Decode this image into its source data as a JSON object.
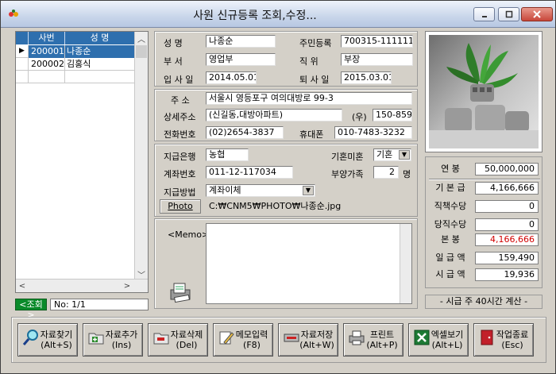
{
  "window": {
    "title": "사원 신규등록 조회,수정..."
  },
  "grid": {
    "columns": [
      "사번",
      "성 명"
    ],
    "rows": [
      {
        "id": "200001",
        "name": "나종순",
        "selected": true
      },
      {
        "id": "200002",
        "name": "김홍식",
        "selected": false
      }
    ],
    "row_marker": "▶"
  },
  "status": {
    "query_label": "<조회>",
    "count": "No: 1/1"
  },
  "basic": {
    "name_label": "성    명",
    "name": "나종순",
    "dept_label": "부    서",
    "dept": "영업부",
    "hire_label": "입 사 일",
    "hire_date": "2014.05.01",
    "rrn_label": "주민등록",
    "rrn": "700315-111111",
    "position_label": "직    위",
    "position": "부장",
    "retire_label": "퇴 사 일",
    "retire_date": "2015.03.01"
  },
  "contact": {
    "address_label": "주    소",
    "address": "서울시 영등포구 여의대방로 99-3",
    "detail_label": "상세주소",
    "detail": "(신길동,대방아파트)",
    "zip_label": "(우)",
    "zip": "150-859",
    "phone_label": "전화번호",
    "phone": "(02)2654-3837",
    "mobile_label": "휴대폰",
    "mobile": "010-7483-3232"
  },
  "payment": {
    "bank_label": "지급은행",
    "bank": "농협",
    "account_label": "계좌번호",
    "account": "011-12-117034",
    "method_label": "지급방법",
    "method": "계좌이체",
    "marital_label": "기혼미혼",
    "marital": "기혼",
    "dependents_label": "부양가족",
    "dependents": "2",
    "dependents_unit": "명",
    "photo_button": "Photo",
    "photo_path": "C:₩CNM5₩PHOTO₩나종순.jpg"
  },
  "memo": {
    "label": "<Memo>",
    "value": ""
  },
  "salary": {
    "annual_label": "연    봉",
    "annual": "50,000,000",
    "base_label": "기 본 급",
    "base": "4,166,666",
    "duty_label": "직책수당",
    "duty": "0",
    "night_label": "당직수당",
    "night": "0",
    "pay_label": "본    봉",
    "pay": "4,166,666",
    "daily_label": "일 급 액",
    "daily": "159,490",
    "hourly_label": "시 급 액",
    "hourly": "19,936",
    "note": "- 시급 주 40시간 계산 -"
  },
  "toolbar": [
    {
      "name": "search",
      "line1": "자료찾기",
      "line2": "(Alt+S)",
      "icon": "magnifier-icon"
    },
    {
      "name": "add",
      "line1": "자료추가",
      "line2": "(Ins)",
      "icon": "folder-add-icon"
    },
    {
      "name": "delete",
      "line1": "자료삭제",
      "line2": "(Del)",
      "icon": "folder-delete-icon"
    },
    {
      "name": "memo",
      "line1": "메모입력",
      "line2": "(F8)",
      "icon": "pencil-icon"
    },
    {
      "name": "save",
      "line1": "자료저장",
      "line2": "(Alt+W)",
      "icon": "save-icon"
    },
    {
      "name": "print",
      "line1": "프린트",
      "line2": "(Alt+P)",
      "icon": "printer-icon"
    },
    {
      "name": "excel",
      "line1": "엑셀보기",
      "line2": "(Alt+L)",
      "icon": "excel-icon"
    },
    {
      "name": "exit",
      "line1": "작업종료",
      "line2": "(Esc)",
      "icon": "exit-door-icon"
    }
  ],
  "colors": {
    "grid_header": "#2e6fae",
    "grid_selected": "#2e6fae",
    "status_green": "#0a8a2a",
    "salary_red": "#d10000"
  }
}
